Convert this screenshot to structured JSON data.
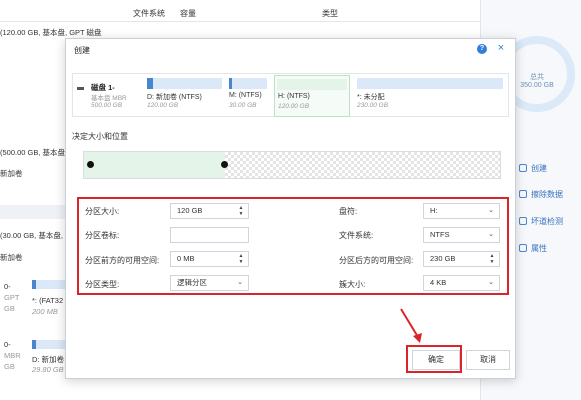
{
  "background": {
    "header": {
      "col_fs": "文件系统",
      "col_cap": "容量",
      "col_type": "类型"
    },
    "left_rows": [
      "(120.00 GB, 基本盘, GPT 磁盘",
      "(500.00 GB, 基本盘, MBR",
      "新加卷",
      "(30.00 GB, 基本盘, MBR)",
      "新加卷"
    ],
    "mini_parts": [
      {
        "label": "*: (FAT32",
        "size": "200 MB"
      },
      {
        "label": "D: 新加卷",
        "size": "29.80 GB"
      }
    ],
    "mini_disks": [
      {
        "name": "0-",
        "line1": "GPT",
        "line2": "GB"
      },
      {
        "name": "0-",
        "line1": "MBR",
        "line2": "GB"
      }
    ],
    "right_panel": {
      "donut_label": "总共",
      "donut_value": "350.00 GB",
      "actions": [
        "创建",
        "擦除数据",
        "坏道检测",
        "属性"
      ]
    }
  },
  "dialog": {
    "title": "创建",
    "help_glyph": "?",
    "close_glyph": "×",
    "disk": {
      "name": "磁盘 1-",
      "line1": "基本盘 MBR",
      "line2": "500.00 GB"
    },
    "partitions": [
      {
        "label": "D: 新加卷 (NTFS)",
        "size": "120.00 GB"
      },
      {
        "label": "M: (NTFS)",
        "size": "30.00 GB"
      },
      {
        "label": "H: (NTFS)",
        "size": "120.00 GB"
      },
      {
        "label": "*: 未分配",
        "size": "230.00 GB"
      }
    ],
    "size_position_label": "决定大小和位置",
    "slider_fraction": 0.34,
    "fields": {
      "partition_size_label": "分区大小:",
      "partition_size_value": "120 GB",
      "partition_label_label": "分区卷标:",
      "partition_label_value": "",
      "space_before_label": "分区前方的可用空间:",
      "space_before_value": "0 MB",
      "partition_type_label": "分区类型:",
      "partition_type_value": "逻辑分区",
      "drive_letter_label": "盘符:",
      "drive_letter_value": "H:",
      "file_system_label": "文件系统:",
      "file_system_value": "NTFS",
      "space_after_label": "分区后方的可用空间:",
      "space_after_value": "230 GB",
      "cluster_size_label": "簇大小:",
      "cluster_size_value": "4 KB"
    },
    "ok_label": "确定",
    "cancel_label": "取消"
  },
  "colors": {
    "accent": "#2f7fd8",
    "highlight_red": "#d9252a",
    "selected_green": "#e5f4e8"
  }
}
